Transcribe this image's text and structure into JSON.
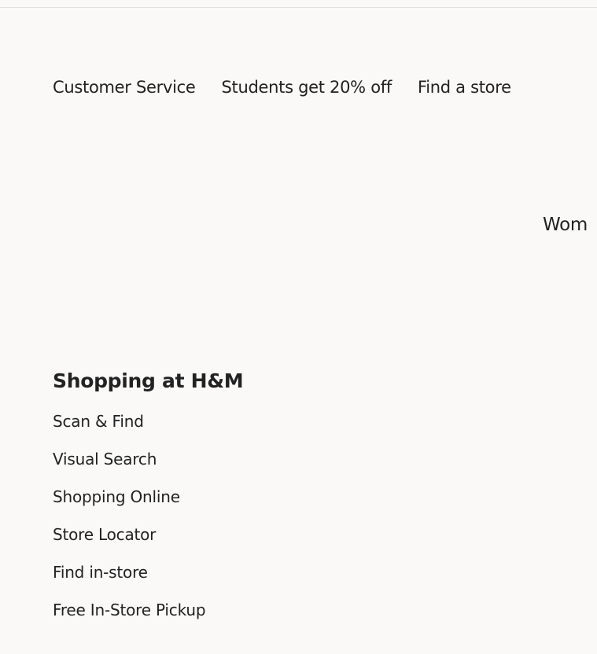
{
  "utility_nav": {
    "items": [
      {
        "label": "Customer Service"
      },
      {
        "label": "Students get 20% off"
      },
      {
        "label": "Find a store"
      }
    ]
  },
  "main_nav": {
    "visible_item": "Wom"
  },
  "footer": {
    "heading": "Shopping at H&M",
    "links": [
      {
        "label": "Scan & Find"
      },
      {
        "label": "Visual Search"
      },
      {
        "label": "Shopping Online"
      },
      {
        "label": "Store Locator"
      },
      {
        "label": "Find in-store"
      },
      {
        "label": "Free In-Store Pickup"
      }
    ]
  },
  "colors": {
    "background": "#faf9f8",
    "text": "#222222",
    "divider": "#e4e2e0"
  }
}
